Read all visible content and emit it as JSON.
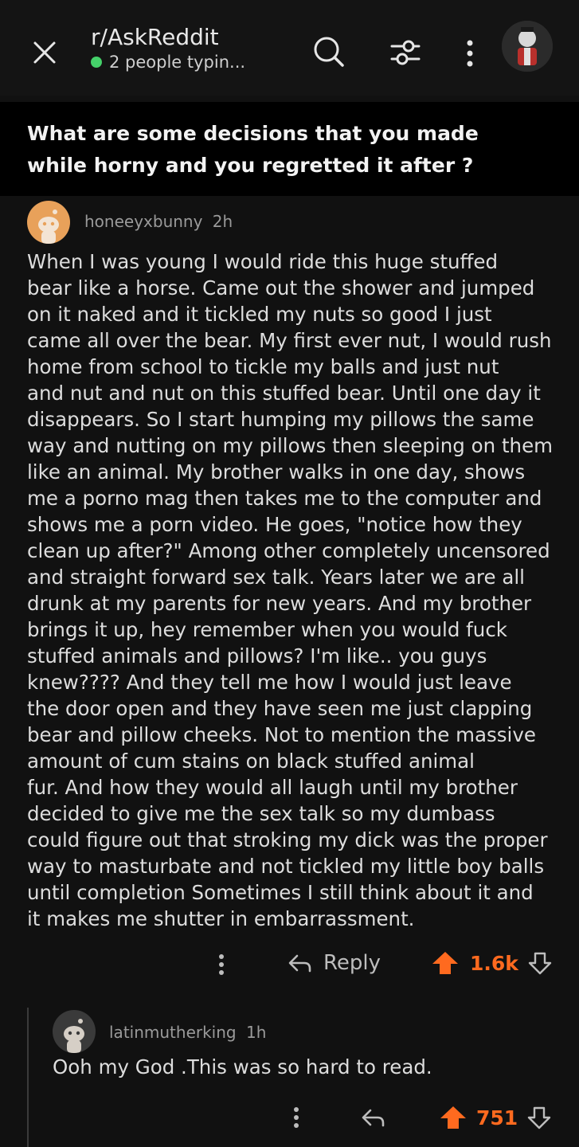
{
  "header": {
    "subreddit": "r/AskReddit",
    "typing_status": "2 people typin...",
    "status_color": "#45d16a"
  },
  "icons": {
    "close": "close-icon",
    "search": "search-icon",
    "filter": "filter-icon",
    "more": "more-vertical-icon",
    "reply": "reply-arrow-icon",
    "upvote": "upvote-arrow-icon",
    "downvote": "downvote-arrow-icon"
  },
  "post": {
    "title": "What are some decisions that you made while horny and you regretted it after ?"
  },
  "comments": [
    {
      "author": "honeeyxbunny",
      "age": "2h",
      "body": "When I was young I would ride this huge stuffed\nbear like a horse. Came out the shower and jumped\non it naked and it tickled my nuts so good I just\ncame all over the bear. My first ever nut, I would rush\nhome from school to tickle my balls and just nut\nand nut and nut on this stuffed bear. Until one day it\ndisappears. So I start humping my pillows the same\nway and nutting on my pillows then sleeping on them\nlike an animal. My brother walks in one day, shows\nme a porno mag then takes me to the computer and\nshows me a porn video. He goes, \"notice how they\nclean up after?\" Among other completely uncensored\nand straight forward sex talk. Years later we are all\ndrunk at my parents for new years. And my brother\nbrings it up, hey remember when you would fuck\nstuffed animals and pillows? I'm like.. you guys\nknew???? And they tell me how I would just leave\nthe door open and they have seen me just clapping\nbear and pillow cheeks. Not to mention the massive\namount of cum stains on black stuffed animal\nfur. And how they would all laugh until my brother\ndecided to give me the sex talk so my dumbass\ncould figure out that stroking my dick was the proper\nway to masturbate and not tickled my little boy balls\nuntil completion Sometimes I still think about it and\nit makes me shutter in embarrassment.",
      "reply_label": "Reply",
      "votes": "1.6k",
      "avatar_color": "#e8a15a"
    },
    {
      "author": "latinmutherking",
      "age": "1h",
      "body": "Ooh my God .This was so hard to read.",
      "votes": "751",
      "avatar_color": "#3a3a3a"
    }
  ],
  "colors": {
    "background": "#111111",
    "upvote_active": "#ff6a1f",
    "muted_text": "#9a9a9a"
  }
}
